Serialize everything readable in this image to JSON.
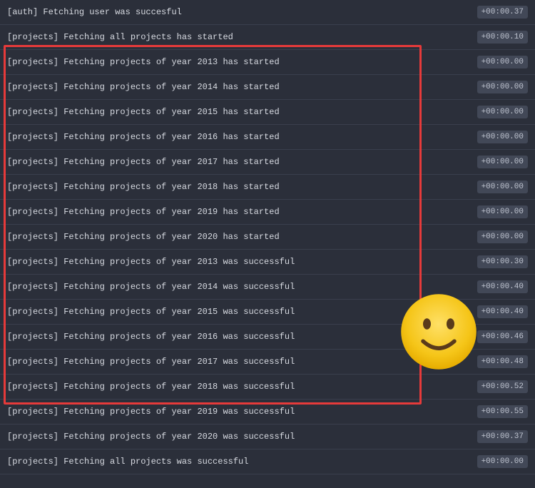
{
  "logs": [
    {
      "text": "[auth] Fetching user was succesful",
      "time": "+00:00.37"
    },
    {
      "text": "[projects] Fetching all projects has started",
      "time": "+00:00.10"
    },
    {
      "text": "[projects] Fetching projects of year 2013 has started",
      "time": "+00:00.00"
    },
    {
      "text": "[projects] Fetching projects of year 2014 has started",
      "time": "+00:00.00"
    },
    {
      "text": "[projects] Fetching projects of year 2015 has started",
      "time": "+00:00.00"
    },
    {
      "text": "[projects] Fetching projects of year 2016 has started",
      "time": "+00:00.00"
    },
    {
      "text": "[projects] Fetching projects of year 2017 has started",
      "time": "+00:00.00"
    },
    {
      "text": "[projects] Fetching projects of year 2018 has started",
      "time": "+00:00.00"
    },
    {
      "text": "[projects] Fetching projects of year 2019 has started",
      "time": "+00:00.00"
    },
    {
      "text": "[projects] Fetching projects of year 2020 has started",
      "time": "+00:00.00"
    },
    {
      "text": "[projects] Fetching projects of year 2013 was successful",
      "time": "+00:00.30"
    },
    {
      "text": "[projects] Fetching projects of year 2014 was successful",
      "time": "+00:00.40"
    },
    {
      "text": "[projects] Fetching projects of year 2015 was successful",
      "time": "+00:00.40"
    },
    {
      "text": "[projects] Fetching projects of year 2016 was successful",
      "time": "+00:00.46"
    },
    {
      "text": "[projects] Fetching projects of year 2017 was successful",
      "time": "+00:00.48"
    },
    {
      "text": "[projects] Fetching projects of year 2018 was successful",
      "time": "+00:00.52"
    },
    {
      "text": "[projects] Fetching projects of year 2019 was successful",
      "time": "+00:00.55"
    },
    {
      "text": "[projects] Fetching projects of year 2020 was successful",
      "time": "+00:00.37"
    },
    {
      "text": "[projects] Fetching all projects was successful",
      "time": "+00:00.00"
    }
  ]
}
